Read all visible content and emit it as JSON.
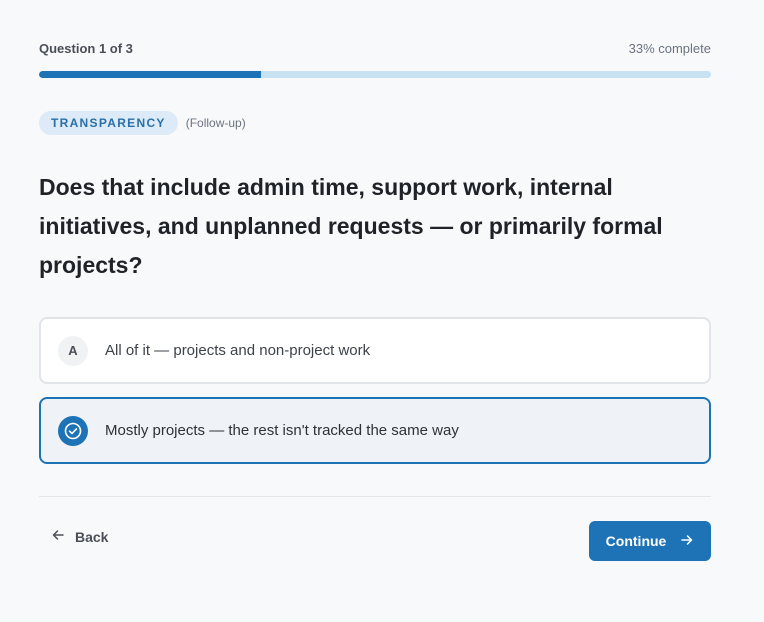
{
  "progress": {
    "question_label": "Question 1 of 3",
    "percent_label": "33% complete",
    "fraction": 0.33
  },
  "tag": {
    "label": "TRANSPARENCY",
    "followup": "(Follow-up)"
  },
  "question": "Does that include admin time, support work, internal initiatives, and unplanned requests — or primarily formal projects?",
  "options": [
    {
      "marker": "A",
      "label": "All of it — projects and non-project work",
      "selected": false
    },
    {
      "marker": "check-circle-icon",
      "label": "Mostly projects — the rest isn't tracked the same way",
      "selected": true
    }
  ],
  "nav": {
    "back_label": "Back",
    "continue_label": "Continue"
  },
  "colors": {
    "accent": "#1d73b6",
    "track": "#c5e1f2",
    "tag_bg": "#dcebf7",
    "tag_text": "#2a6fa8",
    "selected_bg": "#eff3f7"
  }
}
